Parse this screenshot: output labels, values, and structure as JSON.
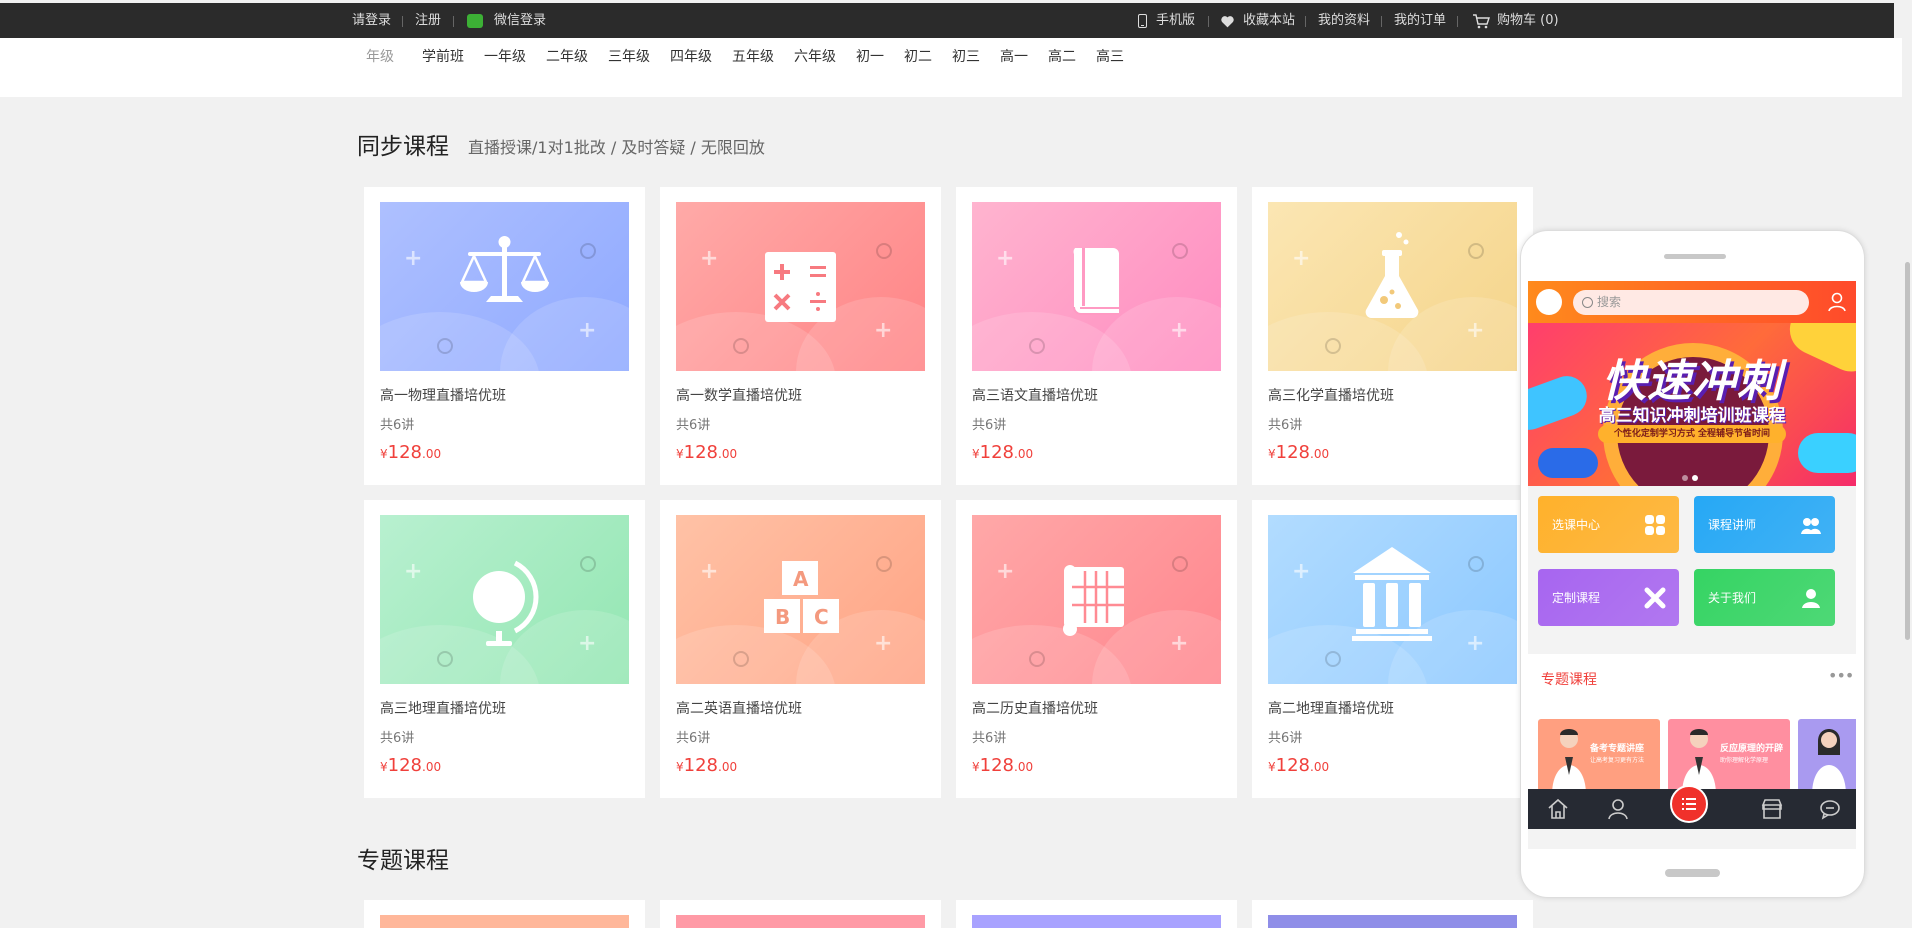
{
  "topbar": {
    "login": "请登录",
    "register": "注册",
    "wechat_login": "微信登录",
    "mobile": "手机版",
    "bookmark": "收藏本站",
    "my_profile": "我的资料",
    "my_orders": "我的订单",
    "cart": "购物车 (0)"
  },
  "grades": {
    "label": "年级",
    "items": [
      "学前班",
      "一年级",
      "二年级",
      "三年级",
      "四年级",
      "五年级",
      "六年级",
      "初一",
      "初二",
      "初三",
      "高一",
      "高二",
      "高三"
    ]
  },
  "sync_section": {
    "title": "同步课程",
    "subtitle": "直播授课/1对1批改 / 及时答疑 / 无限回放"
  },
  "courses": [
    {
      "name": "高一物理直播培优班",
      "lessons": "共6讲",
      "currency": "¥",
      "price_int": "128",
      "price_dec": ".00",
      "icon": "scale-icon",
      "colors": [
        "#aec0ff",
        "#8fa9ff"
      ]
    },
    {
      "name": "高一数学直播培优班",
      "lessons": "共6讲",
      "currency": "¥",
      "price_int": "128",
      "price_dec": ".00",
      "icon": "math-symbols-icon",
      "colors": [
        "#ffaaa8",
        "#ff8385"
      ]
    },
    {
      "name": "高三语文直播培优班",
      "lessons": "共6讲",
      "currency": "¥",
      "price_int": "128",
      "price_dec": ".00",
      "icon": "book-icon",
      "colors": [
        "#ffb4cf",
        "#ff8bc0"
      ]
    },
    {
      "name": "高三化学直播培优班",
      "lessons": "共6讲",
      "currency": "¥",
      "price_int": "128",
      "price_dec": ".00",
      "icon": "flask-icon",
      "colors": [
        "#fbe6b3",
        "#f5d489"
      ]
    },
    {
      "name": "高三地理直播培优班",
      "lessons": "共6讲",
      "currency": "¥",
      "price_int": "128",
      "price_dec": ".00",
      "icon": "globe-icon",
      "colors": [
        "#b8f0d0",
        "#93e6b2"
      ]
    },
    {
      "name": "高二英语直播培优班",
      "lessons": "共6讲",
      "currency": "¥",
      "price_int": "128",
      "price_dec": ".00",
      "icon": "abc-blocks-icon",
      "colors": [
        "#ffc2a6",
        "#ffa384"
      ]
    },
    {
      "name": "高二历史直播培优班",
      "lessons": "共6讲",
      "currency": "¥",
      "price_int": "128",
      "price_dec": ".00",
      "icon": "scroll-icon",
      "colors": [
        "#ffa8a8",
        "#ff858d"
      ]
    },
    {
      "name": "高二地理直播培优班",
      "lessons": "共6讲",
      "currency": "¥",
      "price_int": "128",
      "price_dec": ".00",
      "icon": "museum-icon",
      "colors": [
        "#b2dcff",
        "#8cc8ff"
      ]
    }
  ],
  "topic_section": {
    "title": "专题课程",
    "stub_colors": [
      "#ffb79a",
      "#ff9aa6",
      "#a8a2ff",
      "#8f8ee8"
    ]
  },
  "phone": {
    "search_placeholder": "搜索",
    "banner_title": "快速冲刺",
    "banner_subtitle": "高三知识冲刺培训班课程",
    "banner_tagline": "个性化定制学习方式  全程辅导节省时间",
    "tiles": [
      {
        "label": "选课中心",
        "icon": "grid-icon",
        "color": "#ffb12b"
      },
      {
        "label": "课程讲师",
        "icon": "team-icon",
        "color": "#26a8f5"
      },
      {
        "label": "定制课程",
        "icon": "tools-icon",
        "color": "#a765f0"
      },
      {
        "label": "关于我们",
        "icon": "person-icon",
        "color": "#35d463"
      }
    ],
    "topic_title": "专题课程",
    "topic_more": "•••",
    "topic_cards": [
      {
        "title": "备考专题讲座",
        "sub": "让高考复习更有方法",
        "color": "#ff9f80"
      },
      {
        "title": "反应原理的开辟",
        "sub": "助你理解化学原理",
        "color": "#ff8fa0"
      },
      {
        "title": "",
        "sub": "",
        "color": "#a99af0"
      }
    ],
    "tabbar": [
      "home-icon",
      "user-icon",
      "list-icon",
      "store-icon",
      "chat-icon"
    ]
  }
}
